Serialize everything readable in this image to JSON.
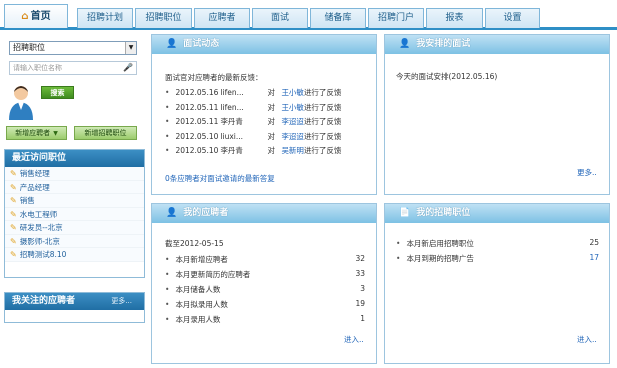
{
  "tabs": [
    {
      "label": "首页",
      "icon": "home-icon"
    },
    {
      "label": "招聘计划"
    },
    {
      "label": "招聘职位"
    },
    {
      "label": "应聘者"
    },
    {
      "label": "面试"
    },
    {
      "label": "储备库"
    },
    {
      "label": "招聘门户"
    },
    {
      "label": "报表"
    },
    {
      "label": "设置"
    }
  ],
  "sidebar": {
    "select_value": "招聘职位",
    "search_placeholder": "请输入职位名称",
    "search_button": "搜索",
    "add_applicant": "新增应聘者",
    "add_position": "新增招聘职位",
    "recent_title": "最近访问职位",
    "recent_items": [
      "销售经理",
      "产品经理",
      "销售",
      "水电工程师",
      "研发员--北京",
      "摄影师-北京",
      "招聘测试8.10"
    ],
    "followed_title": "我关注的应聘者",
    "followed_more": "更多..."
  },
  "interview_panel": {
    "title": "面试动态",
    "intro": "面试官对应聘者的最新反馈：",
    "entries": [
      {
        "date": "2012.05.16",
        "who": "lifen...",
        "to": "对",
        "name": "王小敏",
        "action": "进行了反馈"
      },
      {
        "date": "2012.05.11",
        "who": "lifen...",
        "to": "对",
        "name": "王小敏",
        "action": "进行了反馈"
      },
      {
        "date": "2012.05.11",
        "who": "李丹青",
        "to": "对",
        "name": "李迢迢",
        "action": "进行了反馈"
      },
      {
        "date": "2012.05.10",
        "who": "liuxi...",
        "to": "对",
        "name": "李迢迢",
        "action": "进行了反馈"
      },
      {
        "date": "2012.05.10",
        "who": "李丹青",
        "to": "对",
        "name": "吴新明",
        "action": "进行了反馈"
      }
    ],
    "footer": "0条应聘者对面试邀请的最新答复"
  },
  "my_interviews": {
    "title": "我安排的面试",
    "text": "今天的面试安排(2012.05.16)",
    "more": "更多.."
  },
  "my_applicants": {
    "title": "我的应聘者",
    "as_of": "截至2012-05-15",
    "rows": [
      {
        "label": "本月新增应聘者",
        "value": "32"
      },
      {
        "label": "本月更新简历的应聘者",
        "value": "33"
      },
      {
        "label": "本月储备人数",
        "value": "3"
      },
      {
        "label": "本月拟录用人数",
        "value": "19"
      },
      {
        "label": "本月录用人数",
        "value": "1"
      }
    ],
    "enter": "进入.."
  },
  "my_positions": {
    "title": "我的招聘职位",
    "rows": [
      {
        "label": "本月新启用招聘职位",
        "value": "25"
      },
      {
        "label": "本月到期的招聘广告",
        "value": "17"
      }
    ],
    "enter": "进入.."
  }
}
